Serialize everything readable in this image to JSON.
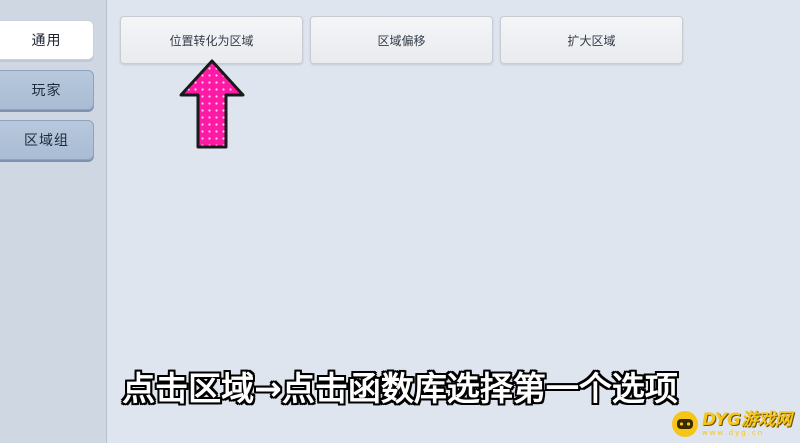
{
  "sidebar": {
    "tabs": [
      {
        "label": "通用",
        "active": true
      },
      {
        "label": "玩家",
        "active": false
      },
      {
        "label": "区域组",
        "active": false
      }
    ]
  },
  "toolbar": {
    "buttons": [
      {
        "label": "位置转化为区域"
      },
      {
        "label": "区域偏移"
      },
      {
        "label": "扩大区域"
      }
    ]
  },
  "caption": {
    "text": "点击区域→点击函数库选择第一个选项"
  },
  "watermark": {
    "main": "DYG游戏网",
    "sub": "www.dyg.cn"
  },
  "colors": {
    "arrow_fill": "#ff1aa6",
    "caption_text": "#ffffff",
    "watermark": "#f5c518"
  }
}
